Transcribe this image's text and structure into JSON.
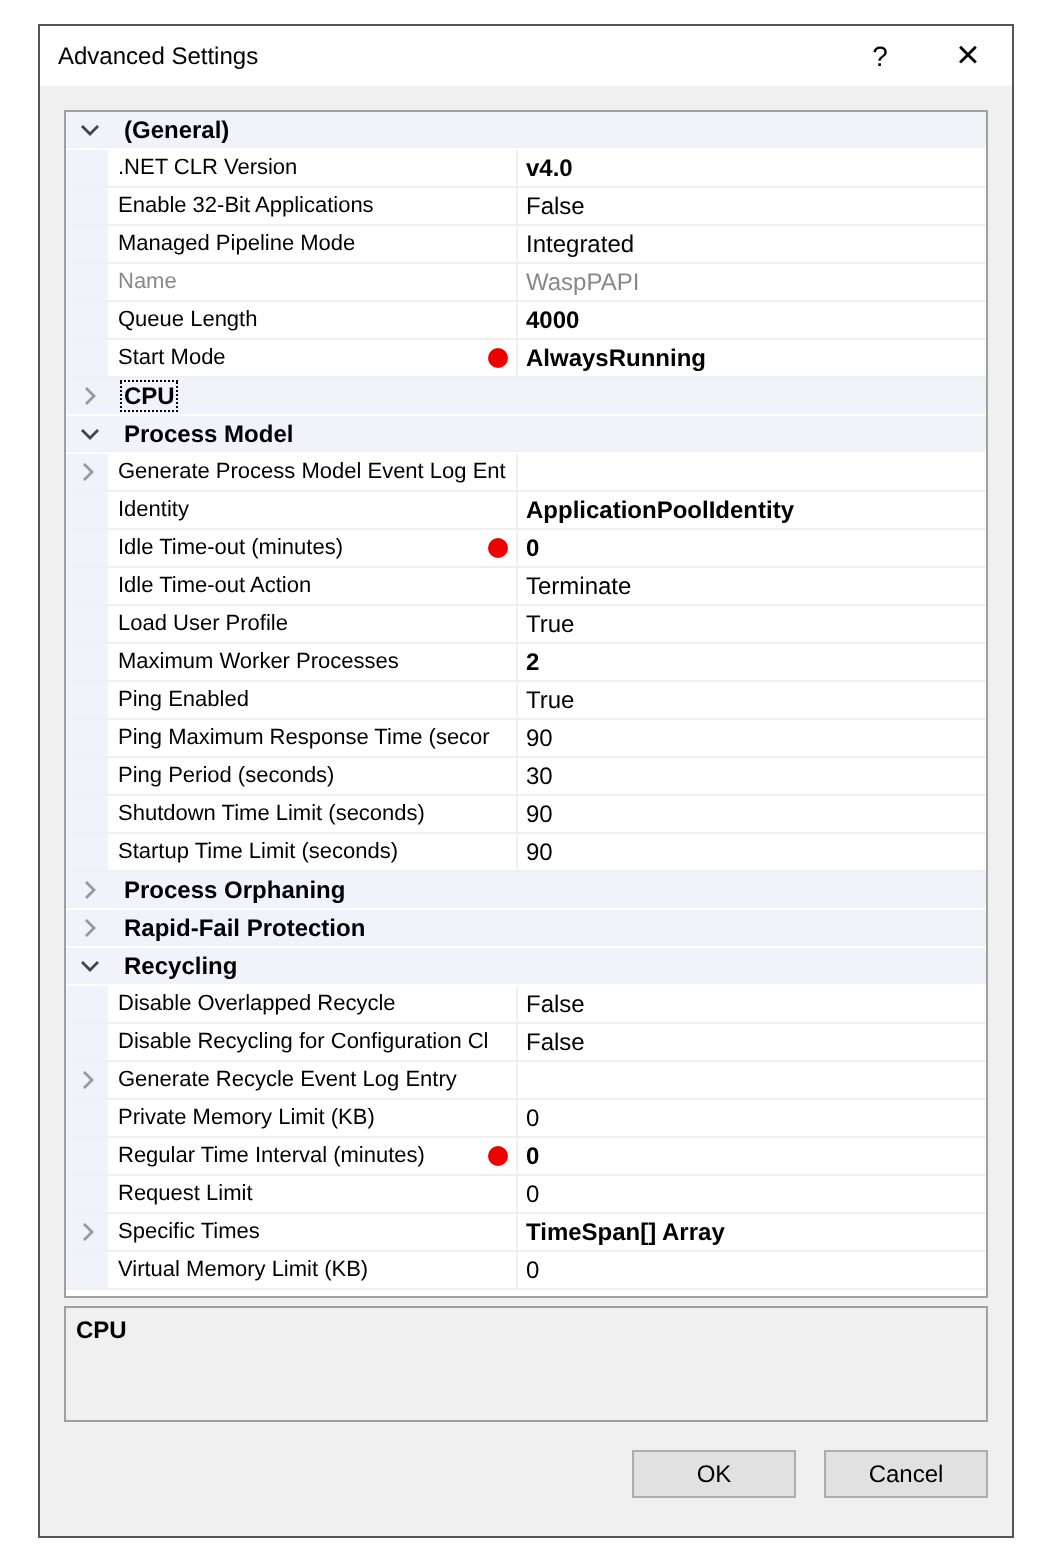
{
  "window": {
    "title": "Advanced Settings",
    "help_button": "?",
    "close_button": "×"
  },
  "categories": [
    {
      "name": "(General)",
      "expanded": true,
      "selected": false,
      "properties": [
        {
          "name": ".NET CLR Version",
          "value": "v4.0",
          "bold": true
        },
        {
          "name": "Enable 32-Bit Applications",
          "value": "False"
        },
        {
          "name": "Managed Pipeline Mode",
          "value": "Integrated"
        },
        {
          "name": "Name",
          "value": "WaspPAPI",
          "disabled": true
        },
        {
          "name": "Queue Length",
          "value": "4000",
          "bold": true
        },
        {
          "name": "Start Mode",
          "value": "AlwaysRunning",
          "bold": true,
          "marked": true
        }
      ]
    },
    {
      "name": "CPU",
      "expanded": false,
      "selected": true
    },
    {
      "name": "Process Model",
      "expanded": true,
      "selected": false,
      "properties": [
        {
          "name": "Generate Process Model Event Log Ent",
          "expandable": true
        },
        {
          "name": "Identity",
          "value": "ApplicationPoolIdentity",
          "bold": true
        },
        {
          "name": "Idle Time-out (minutes)",
          "value": "0",
          "bold": true,
          "marked": true
        },
        {
          "name": "Idle Time-out Action",
          "value": "Terminate"
        },
        {
          "name": "Load User Profile",
          "value": "True"
        },
        {
          "name": "Maximum Worker Processes",
          "value": "2",
          "bold": true
        },
        {
          "name": "Ping Enabled",
          "value": "True"
        },
        {
          "name": "Ping Maximum Response Time (secor",
          "value": "90"
        },
        {
          "name": "Ping Period (seconds)",
          "value": "30"
        },
        {
          "name": "Shutdown Time Limit (seconds)",
          "value": "90"
        },
        {
          "name": "Startup Time Limit (seconds)",
          "value": "90"
        }
      ]
    },
    {
      "name": "Process Orphaning",
      "expanded": false,
      "selected": false
    },
    {
      "name": "Rapid-Fail Protection",
      "expanded": false,
      "selected": false
    },
    {
      "name": "Recycling",
      "expanded": true,
      "selected": false,
      "properties": [
        {
          "name": "Disable Overlapped Recycle",
          "value": "False"
        },
        {
          "name": "Disable Recycling for Configuration Cl",
          "value": "False"
        },
        {
          "name": "Generate Recycle Event Log Entry",
          "expandable": true
        },
        {
          "name": "Private Memory Limit (KB)",
          "value": "0"
        },
        {
          "name": "Regular Time Interval (minutes)",
          "value": "0",
          "bold": true,
          "marked": true
        },
        {
          "name": "Request Limit",
          "value": "0"
        },
        {
          "name": "Specific Times",
          "value": "TimeSpan[] Array",
          "bold": true,
          "expandable": true
        },
        {
          "name": "Virtual Memory Limit (KB)",
          "value": "0"
        }
      ]
    }
  ],
  "description": {
    "title": "CPU"
  },
  "buttons": [
    {
      "label": "OK"
    },
    {
      "label": "Cancel"
    }
  ]
}
